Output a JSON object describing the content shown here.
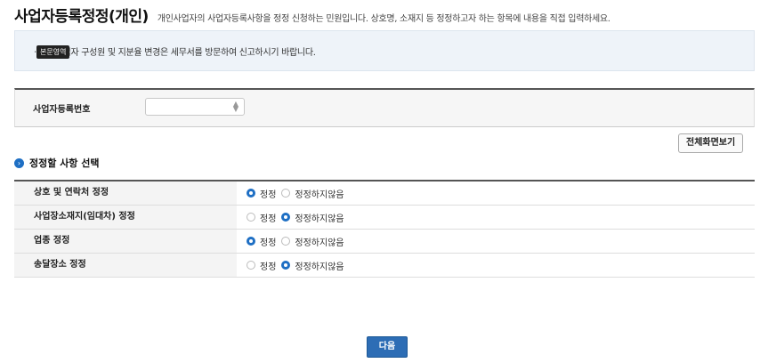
{
  "header": {
    "title": "사업자등록정정(개인)",
    "description": "개인사업자의 사업자등록사항을 정정 신청하는 민원입니다. 상호명, 소재지 등 정정하고자 하는 항목에 내용을 직접 입력하세요."
  },
  "notice": {
    "text": "ㆍ공동사업자 구성원 및 지분율 변경은 세무서를 방문하여 신고하시기 바랍니다.",
    "tooltip": "본문영역"
  },
  "business": {
    "label": "사업자등록번호",
    "select_value": ""
  },
  "fullview_button": "전체화면보기",
  "section": {
    "title": "정정할 사항 선택",
    "option_yes": "정정",
    "option_no": "정정하지않음"
  },
  "rows": [
    {
      "label": "상호 및 연락처 정정",
      "selected": "정정"
    },
    {
      "label": "사업장소재지(임대차) 정정",
      "selected": "정정하지않음"
    },
    {
      "label": "업종 정정",
      "selected": "정정"
    },
    {
      "label": "송달장소 정정",
      "selected": "정정하지않음"
    }
  ],
  "next_button": "다음",
  "colors": {
    "accent": "#1e6fc4",
    "button": "#2d6db5"
  }
}
